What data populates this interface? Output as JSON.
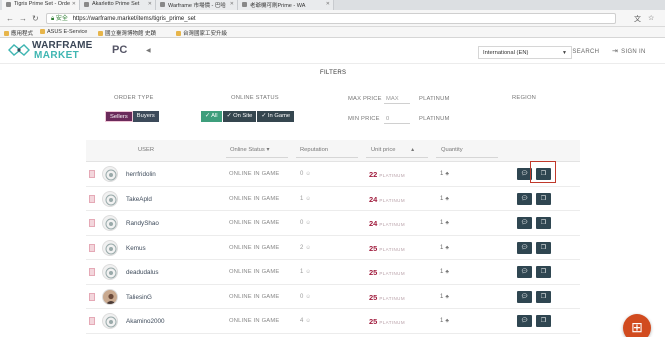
{
  "browser": {
    "tabs": [
      {
        "label": "Tigris Prime Set - Orde"
      },
      {
        "label": "Akarletto Prime Set"
      },
      {
        "label": "Warframe 市場價 - 巴哈"
      },
      {
        "label": "老爺機可刷Prime - WA"
      }
    ],
    "address": {
      "secure_label": "安全",
      "url": "https://warframe.market/items/tigris_prime_set"
    },
    "bookmarks": [
      {
        "label": "應用程式"
      },
      {
        "label": "ASUS E-Service"
      },
      {
        "label": "國立臺灣博物館 史蹟"
      },
      {
        "label": "台灣國家工安升級"
      }
    ]
  },
  "site": {
    "logo_line1": "WARFRAME",
    "logo_line2": "MARKET",
    "platform": "PC",
    "search_label": "SEARCH",
    "signin_label": "SIGN IN"
  },
  "filters": {
    "title": "FILTERS",
    "order_type_label": "ORDER TYPE",
    "sellers_label": "Sellers",
    "buyers_label": "Buyers",
    "online_status_label": "ONLINE STATUS",
    "all_label": "All",
    "on_site_label": "On Site",
    "in_game_label": "In Game",
    "max_price_label": "MAX PRICE",
    "max_placeholder": "MAX",
    "min_price_label": "MIN PRICE",
    "min_value": "0",
    "platinum_label": "PLATINUM",
    "region_label": "REGION",
    "region_value": "International (EN)"
  },
  "table": {
    "columns": {
      "user": "USER",
      "online_status": "Online Status",
      "reputation": "Reputation",
      "unit_price": "Unit price",
      "quantity": "Quantity"
    },
    "platinum_suffix": "PLATINUM",
    "rows": [
      {
        "user": "herrfridolin",
        "status": "ONLINE IN GAME",
        "reputation": "0",
        "price": "22",
        "quantity": "1"
      },
      {
        "user": "TakeApld",
        "status": "ONLINE IN GAME",
        "reputation": "1",
        "price": "24",
        "quantity": "1"
      },
      {
        "user": "RandyShao",
        "status": "ONLINE IN GAME",
        "reputation": "0",
        "price": "24",
        "quantity": "1"
      },
      {
        "user": "Kemus",
        "status": "ONLINE IN GAME",
        "reputation": "2",
        "price": "25",
        "quantity": "1"
      },
      {
        "user": "deadudalus",
        "status": "ONLINE IN GAME",
        "reputation": "1",
        "price": "25",
        "quantity": "1"
      },
      {
        "user": "TaliesinG",
        "status": "ONLINE IN GAME",
        "reputation": "0",
        "price": "25",
        "quantity": "1"
      },
      {
        "user": "Akamino2000",
        "status": "ONLINE IN GAME",
        "reputation": "4",
        "price": "25",
        "quantity": "1"
      }
    ]
  },
  "colors": {
    "price": "#a11d3e",
    "logo_accent": "#3fb6b2",
    "action_button": "#2f4651",
    "highlight": "#c0392b",
    "fab": "#d14b1f"
  },
  "icons": {
    "message": "message-icon",
    "copy": "copy-icon",
    "fab": "add-icon"
  }
}
